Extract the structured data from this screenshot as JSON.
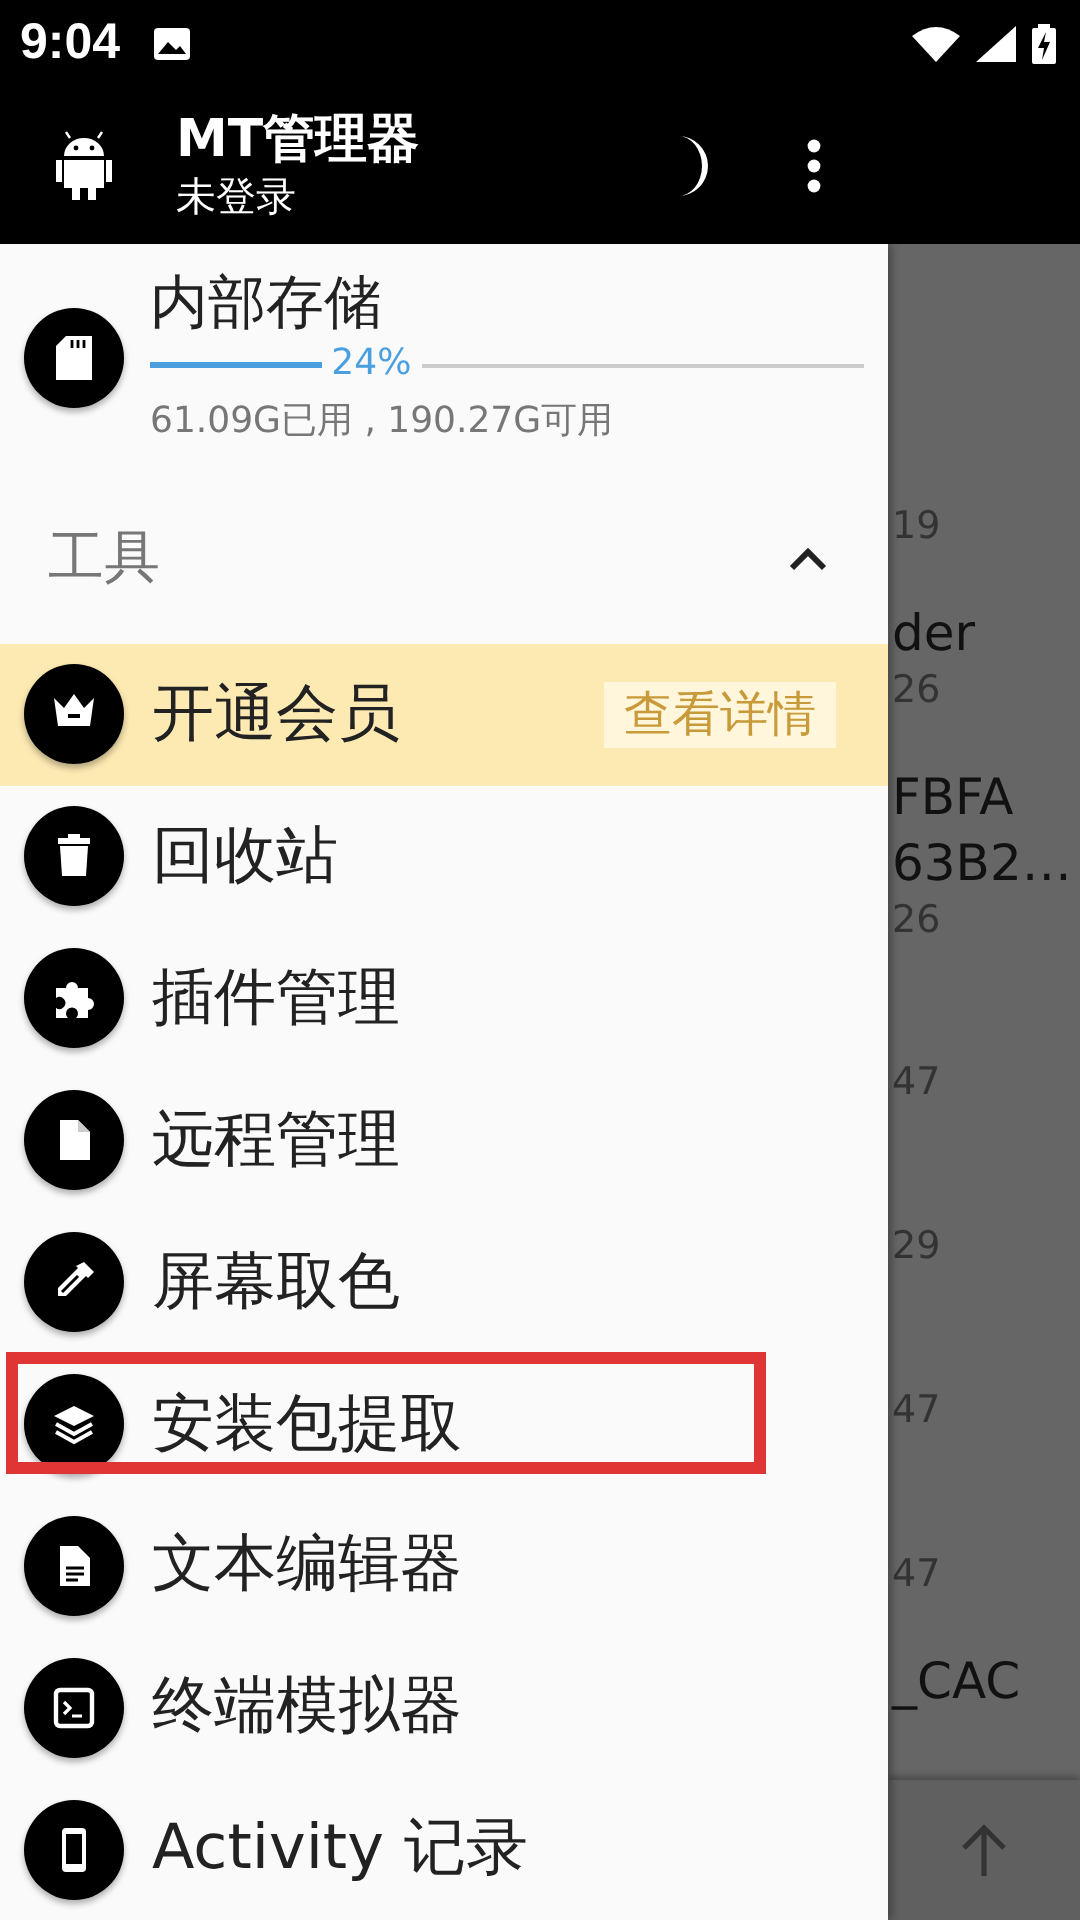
{
  "status_bar": {
    "time": "9:04"
  },
  "app_bar": {
    "title": "MT管理器",
    "subtitle": "未登录"
  },
  "storage": {
    "title": "内部存储",
    "level": 0.24,
    "percent": "24%",
    "usage": "61.09G已用 , 190.27G可用"
  },
  "section": {
    "title": "工具",
    "expanded": true
  },
  "tools": [
    {
      "kind": "promo",
      "label": "开通会员",
      "action": "查看详情",
      "marked": false
    },
    {
      "kind": "tool",
      "label": "回收站",
      "marked": false
    },
    {
      "kind": "tool",
      "label": "插件管理",
      "marked": false
    },
    {
      "kind": "tool",
      "label": "远程管理",
      "marked": false
    },
    {
      "kind": "tool",
      "label": "屏幕取色",
      "marked": false
    },
    {
      "kind": "tool",
      "label": "安装包提取",
      "marked": true
    },
    {
      "kind": "tool",
      "label": "文本编辑器",
      "marked": false
    },
    {
      "kind": "tool",
      "label": "终端模拟器",
      "marked": false
    },
    {
      "kind": "tool",
      "label": "Activity 记录",
      "marked": false
    }
  ],
  "background_files": [
    {
      "meta": "19"
    },
    {
      "name": [
        "der"
      ],
      "meta": "26"
    },
    {
      "name": [
        "FBFA",
        "63B2…"
      ],
      "meta": "26"
    },
    {
      "meta": "47"
    },
    {
      "meta": "29"
    },
    {
      "meta": "47"
    },
    {
      "meta": "47"
    },
    {
      "name": [
        "_CAC"
      ]
    }
  ]
}
